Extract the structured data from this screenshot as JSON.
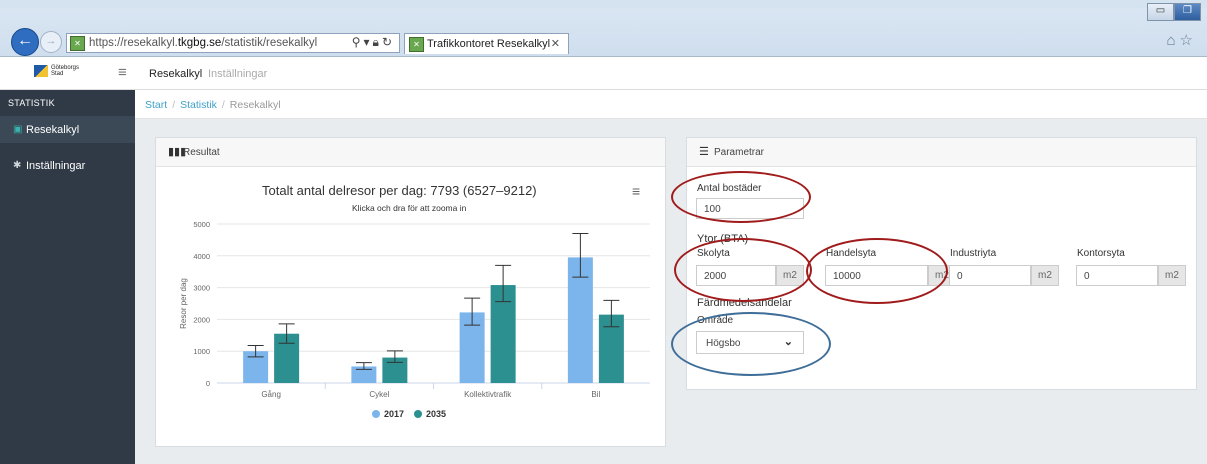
{
  "browser": {
    "url_prefix": "https://resekalkyl.",
    "url_domain": "tkgbg.se",
    "url_path": "/statistik/resekalkyl",
    "tab_title": "Trafikkontoret Resekalkyl"
  },
  "header": {
    "logo_line1": "Göteborgs",
    "logo_line2": "Stad",
    "nav": [
      "Resekalkyl",
      "Inställningar"
    ]
  },
  "sidebar": {
    "heading": "STATISTIK",
    "items": [
      {
        "label": "Resekalkyl",
        "icon": "bus-icon"
      },
      {
        "label": "Inställningar",
        "icon": "gear-icon"
      }
    ]
  },
  "breadcrumb": [
    "Start",
    "Statistik",
    "Resekalkyl"
  ],
  "results_panel": {
    "title": "Resultat"
  },
  "params_panel": {
    "title": "Parametrar",
    "antal_label": "Antal bostäder",
    "antal_value": "100",
    "ytor_heading": "Ytor (BTA)",
    "fields": [
      {
        "label": "Skolyta",
        "value": "2000",
        "unit": "m2"
      },
      {
        "label": "Handelsyta",
        "value": "10000",
        "unit": "m2"
      },
      {
        "label": "Industriyta",
        "value": "0",
        "unit": "m2"
      },
      {
        "label": "Kontorsyta",
        "value": "0",
        "unit": "m2"
      }
    ],
    "fardmedel_heading": "Färdmedelsandelar",
    "omrade_label": "Område",
    "omrade_value": "Högsbo"
  },
  "chart_data": {
    "type": "bar",
    "title": "Totalt antal delresor per dag: 7793 (6527–9212)",
    "subtitle": "Klicka och dra för att zooma in",
    "ylabel": "Resor per dag",
    "ylim": [
      0,
      5000
    ],
    "yticks": [
      0,
      1000,
      2000,
      3000,
      4000,
      5000
    ],
    "categories": [
      "Gång",
      "Cykel",
      "Kollektivtrafik",
      "Bil"
    ],
    "series": [
      {
        "name": "2017",
        "color": "#7cb5ec",
        "values": [
          1000,
          520,
          2220,
          3950
        ],
        "low": [
          820,
          430,
          1820,
          3330
        ],
        "high": [
          1180,
          640,
          2670,
          4700
        ]
      },
      {
        "name": "2035",
        "color": "#2b908f",
        "values": [
          1550,
          800,
          3080,
          2150
        ],
        "low": [
          1250,
          650,
          2560,
          1770
        ],
        "high": [
          1860,
          1010,
          3700,
          2600
        ]
      }
    ],
    "legend": "bottom-center"
  }
}
